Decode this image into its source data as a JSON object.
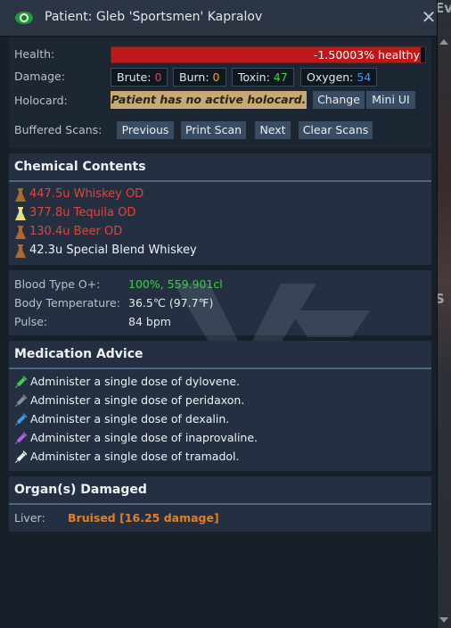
{
  "window": {
    "title": "Patient: Gleb 'Sportsmen' Kapralov",
    "icons": {
      "eye": "eye-icon",
      "close": "close-icon"
    },
    "close_glyph": "✕"
  },
  "background": {
    "text_top": "Even",
    "text_mid": "S"
  },
  "summary": {
    "health_label": "Health:",
    "health_value": "-1.50003% healthy",
    "health_fraction": 0.985,
    "damage_label": "Damage:",
    "damage": [
      {
        "label": "Brute:",
        "value": "0",
        "color": "#e0453a"
      },
      {
        "label": "Burn:",
        "value": "0",
        "color": "#e8a234"
      },
      {
        "label": "Toxin:",
        "value": "47",
        "color": "#3ecf45"
      },
      {
        "label": "Oxygen:",
        "value": "54",
        "color": "#3c9ae8"
      }
    ],
    "holocard_label": "Holocard:",
    "holocard_note": "Patient has no active holocard.",
    "holocard_buttons": {
      "change": "Change",
      "mini_ui": "Mini UI"
    },
    "scans_label": "Buffered Scans:",
    "scan_buttons": {
      "previous": "Previous",
      "print": "Print Scan",
      "next": "Next",
      "clear": "Clear Scans"
    }
  },
  "chemicals": {
    "title": "Chemical Contents",
    "items": [
      {
        "text": "447.5u Whiskey OD",
        "color": "#e0453a",
        "icon": "beaker-icon",
        "icon_color": "#a86c2a"
      },
      {
        "text": "377.8u Tequila OD",
        "color": "#e0453a",
        "icon": "beaker-icon",
        "icon_color": "#e6df8a"
      },
      {
        "text": "130.4u Beer OD",
        "color": "#e0453a",
        "icon": "beaker-icon",
        "icon_color": "#a86c2a"
      },
      {
        "text": "42.3u Special Blend Whiskey",
        "color": "#eef1f4",
        "icon": "beaker-icon",
        "icon_color": "#a86c2a"
      }
    ]
  },
  "vitals": {
    "blood_label": "Blood Type O+:",
    "blood_value": "100%, 559.901cl",
    "blood_color": "#3ecf45",
    "temp_label": "Body Temperature:",
    "temp_value": "36.5℃ (97.7℉)",
    "pulse_label": "Pulse:",
    "pulse_value": "84 bpm"
  },
  "advice": {
    "title": "Medication Advice",
    "items": [
      {
        "text": "Administer a single dose of dylovene.",
        "icon": "syringe-icon",
        "icon_color": "#3ecf45"
      },
      {
        "text": "Administer a single dose of peridaxon.",
        "icon": "syringe-icon",
        "icon_color": "#8a8f96"
      },
      {
        "text": "Administer a single dose of dexalin.",
        "icon": "syringe-icon",
        "icon_color": "#3c9ae8"
      },
      {
        "text": "Administer a single dose of inaprovaline.",
        "icon": "syringe-icon",
        "icon_color": "#b35fe0"
      },
      {
        "text": "Administer a single dose of tramadol.",
        "icon": "syringe-icon",
        "icon_color": "#f1f3f5"
      }
    ]
  },
  "organs": {
    "title": "Organ(s) Damaged",
    "liver_label": "Liver:",
    "liver_value": "Bruised [16.25 damage]",
    "liver_color": "#e67e22"
  }
}
